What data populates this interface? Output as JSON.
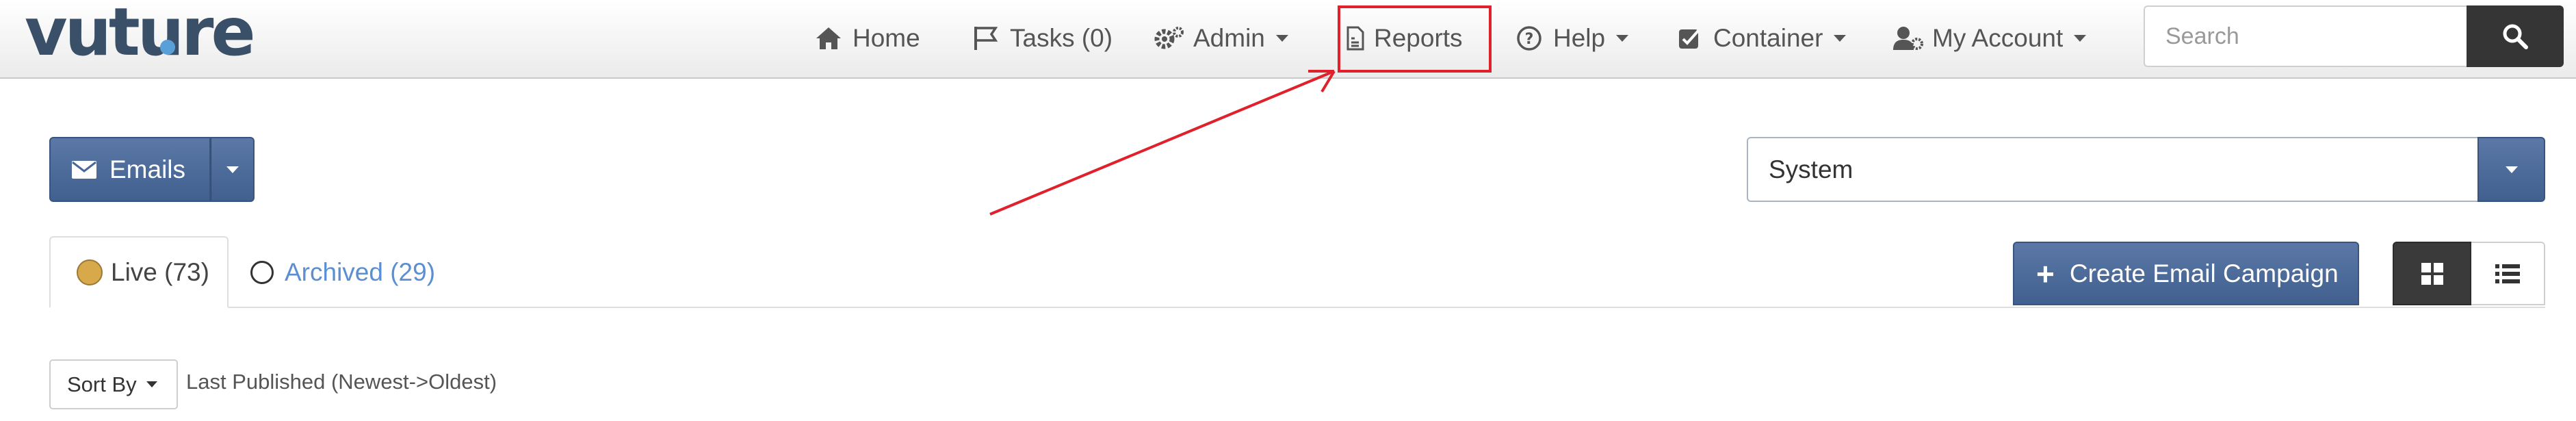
{
  "logo": {
    "text": "vuture"
  },
  "nav": {
    "items": [
      {
        "label": "Home",
        "icon": "home-icon"
      },
      {
        "label": "Tasks (0)",
        "icon": "flag-icon"
      },
      {
        "label": "Admin",
        "icon": "cogs-icon",
        "dropdown": true
      },
      {
        "label": "Reports",
        "icon": "report-file-icon"
      },
      {
        "label": "Help",
        "icon": "question-circle-icon",
        "dropdown": true
      },
      {
        "label": "Container",
        "icon": "check-square-icon",
        "dropdown": true
      },
      {
        "label": "My Account",
        "icon": "user-cog-icon",
        "dropdown": true
      }
    ],
    "highlighted": "Reports"
  },
  "search": {
    "placeholder": "Search",
    "button_icon": "search-icon"
  },
  "emails_button": {
    "label": "Emails",
    "icon": "envelope-icon"
  },
  "system_select": {
    "value": "System"
  },
  "tabs": [
    {
      "label": "Live (73)",
      "active": true,
      "status_color": "#d7a94b"
    },
    {
      "label": "Archived (29)",
      "active": false
    }
  ],
  "create_button": {
    "label": "Create Email Campaign",
    "icon": "plus-icon"
  },
  "view_toggle": {
    "grid_icon": "grid-icon",
    "list_icon": "list-icon",
    "active": "grid"
  },
  "sort": {
    "label": "Sort By",
    "value": "Last Published (Newest->Oldest)"
  },
  "colors": {
    "primary": "#4a6796",
    "annotation": "#e0202b",
    "link": "#5b8fd1",
    "dark": "#353535"
  }
}
